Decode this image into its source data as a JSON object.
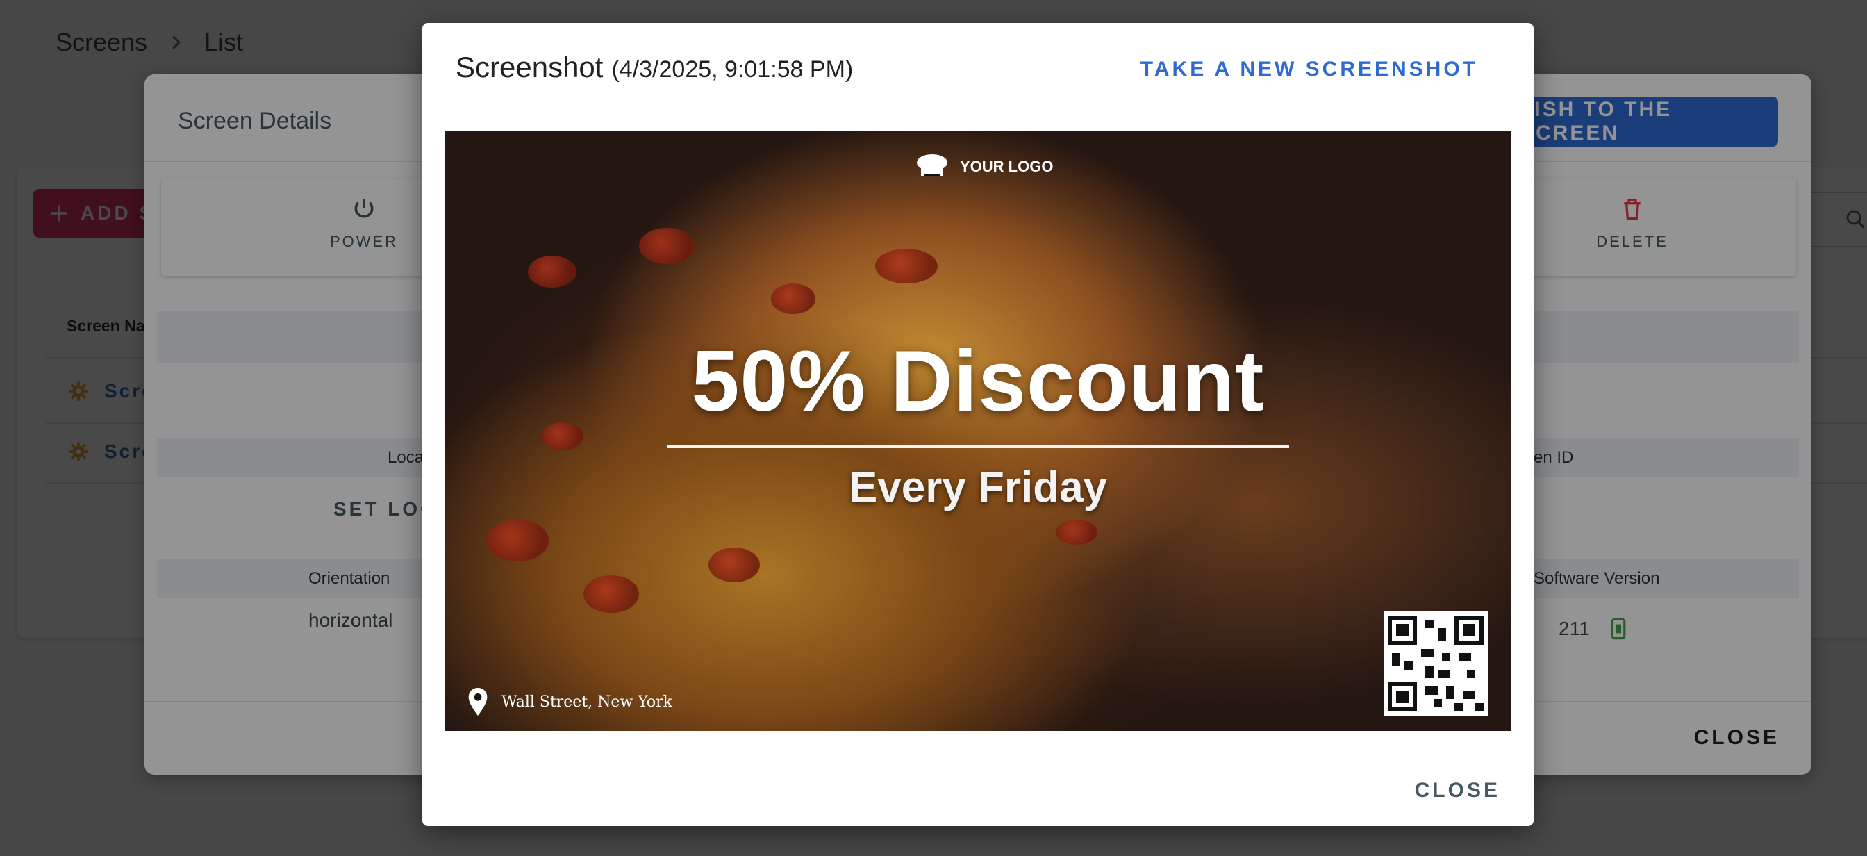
{
  "breadcrumb": {
    "root": "Screens",
    "current": "List"
  },
  "list": {
    "add_button": "ADD S",
    "column_header": "Screen Na",
    "rows": [
      {
        "label": "Scre"
      },
      {
        "label": "Scre"
      }
    ]
  },
  "detail": {
    "title": "Screen Details",
    "publish_button": "LISH TO THE SCREEN",
    "actions": {
      "power": "POWER",
      "delete": "DELETE"
    },
    "fields": {
      "location_label": "Loca",
      "set_location": "SET LOC",
      "screen_id_label": "en ID",
      "orientation_label": "Orientation",
      "orientation_value": "horizontal",
      "software_label": "Software Version",
      "software_value": "211"
    },
    "close_button": "CLOSE"
  },
  "screenshot_dialog": {
    "title": "Screenshot",
    "timestamp": "(4/3/2025, 9:01:58 PM)",
    "take_new_button": "TAKE A NEW SCREENSHOT",
    "close_button": "CLOSE",
    "image": {
      "logo_text": "YOUR LOGO",
      "headline": "50% Discount",
      "subheadline": "Every Friday",
      "address": "Wall Street, New York"
    }
  },
  "colors": {
    "accent_blue": "#2f6ad0",
    "add_button_pink": "#e03565",
    "delete_red": "#e53935",
    "row_gear_orange": "#e9a23b",
    "status_green": "#43a047"
  }
}
